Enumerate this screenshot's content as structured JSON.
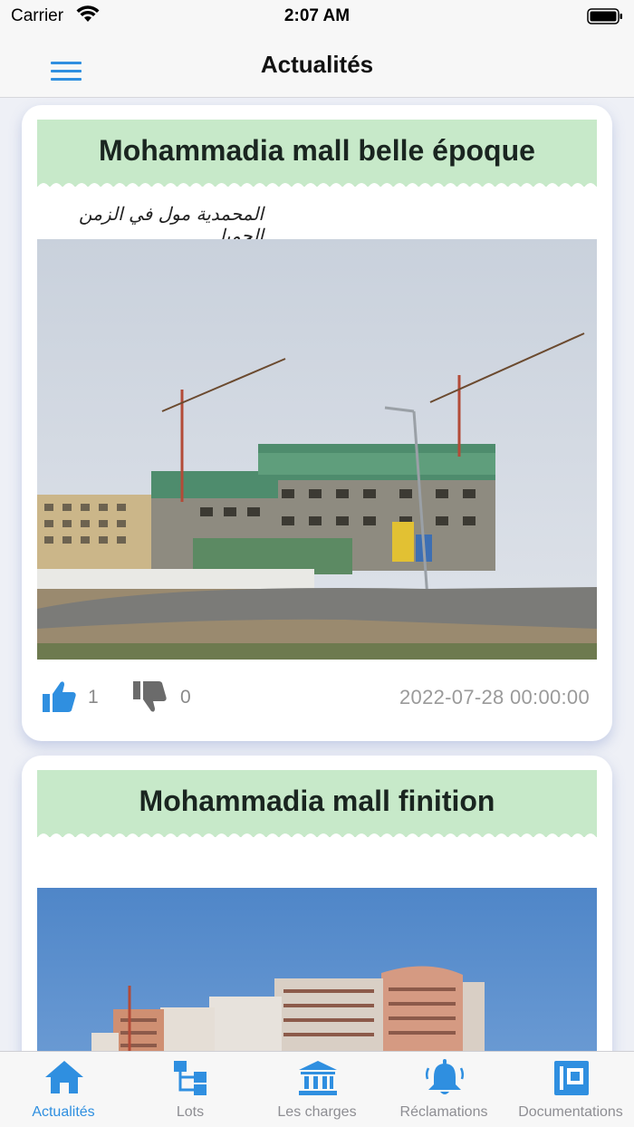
{
  "status_bar": {
    "carrier": "Carrier",
    "time": "2:07 AM",
    "icons": [
      "wifi-icon",
      "battery-icon"
    ]
  },
  "nav_bar": {
    "title": "Actualités",
    "menu_icon": "menu-icon"
  },
  "posts": [
    {
      "title": "Mohammadia mall belle époque",
      "subtitle": "المحمدية مول في الزمن الجميل",
      "image": "construction site with cranes",
      "likes": "1",
      "dislikes": "0",
      "date": "2022-07-28 00:00:00"
    },
    {
      "title": "Mohammadia mall finition",
      "subtitle": "",
      "image": "finished building under blue sky"
    }
  ],
  "tab_bar": {
    "active": "Actualités",
    "tabs": [
      {
        "label": "Actualités",
        "icon": "home-icon"
      },
      {
        "label": "Lots",
        "icon": "hierarchy-icon"
      },
      {
        "label": "Les charges",
        "icon": "bank-icon"
      },
      {
        "label": "Réclamations",
        "icon": "bell-icon"
      },
      {
        "label": "Documentations",
        "icon": "document-icon"
      }
    ]
  },
  "colors": {
    "accent": "#2f8fe0",
    "header_green": "#c7e9c9",
    "inactive": "#8e8e93"
  }
}
